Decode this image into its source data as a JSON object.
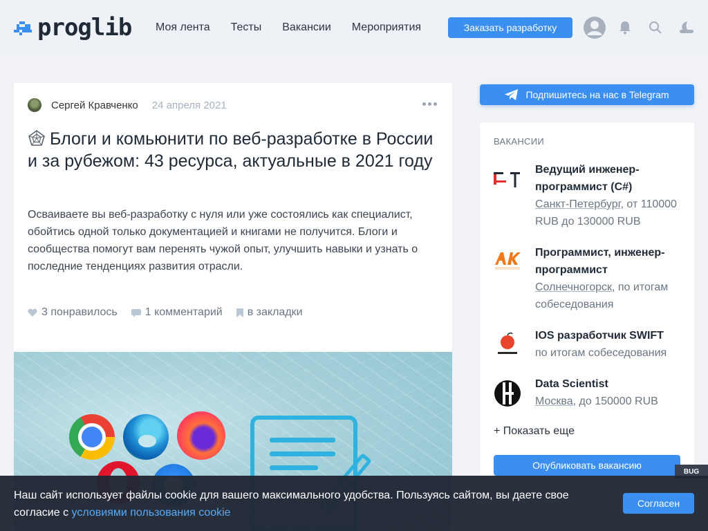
{
  "header": {
    "logo_text": "proglib",
    "nav": [
      "Моя лента",
      "Тесты",
      "Вакансии",
      "Мероприятия"
    ],
    "order_button": "Заказать разработку",
    "icons": [
      "user-avatar-icon",
      "bell-icon",
      "search-icon",
      "moon-icon"
    ]
  },
  "article": {
    "author": "Сергей Кравченко",
    "date": "24 апреля 2021",
    "title": "Блоги и комьюнити по веб-разработке в России и за рубежом: 43 ресурса, актуальные в 2021 году",
    "lead": "Осваиваете вы веб-разработку с нуля или уже состоялись как специалист, обойтись одной только документацией и книгами не получится. Блоги и сообщества помогут вам перенять чужой опыт, улучшить навыки и узнать о последние тенденциях развития отрасли.",
    "likes": "3 понравилось",
    "comments": "1 комментарий",
    "bookmark": "в закладки"
  },
  "sidebar": {
    "telegram_button": "Подпишитесь на нас в Telegram",
    "vacancies_heading": "ВАКАНСИИ",
    "vacancies": [
      {
        "title": "Ведущий инженер-программист (C#)",
        "city": "Санкт-Петербург",
        "conditions": ", от 110000 RUB до 130000 RUB"
      },
      {
        "title": "Программист, инженер-программист",
        "city": "Солнечногорск",
        "conditions": ", по итогам собеседования"
      },
      {
        "title": "IOS разработчик SWIFT",
        "city": "",
        "conditions": "по итогам собеседования"
      },
      {
        "title": "Data Scientist",
        "city": "Москва",
        "conditions": ", до 150000 RUB"
      }
    ],
    "show_more": "+ Показать еще",
    "publish_button": "Опубликовать вакансию",
    "bug_label": "BUG"
  },
  "cookie": {
    "text": "Наш сайт использует файлы cookie для вашего максимального удобства. Пользуясь сайтом, вы даете свое согласие с ",
    "link": "условиями пользования cookie",
    "button": "Согласен"
  },
  "colors": {
    "accent": "#3b8ff0",
    "header_bg": "#eef1f6",
    "page_bg": "#f0f2f5",
    "cookie_bg": "#212834"
  }
}
